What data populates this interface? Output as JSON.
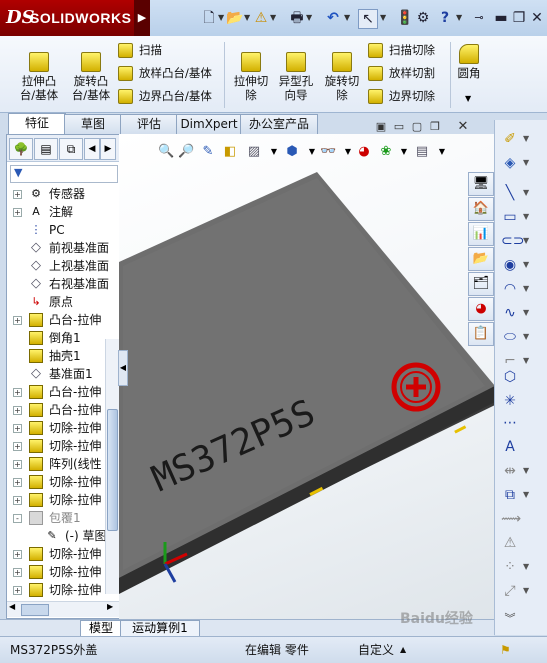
{
  "app": {
    "logo_text": "SOLIDWORKS",
    "logo_mark": "DS"
  },
  "colors": {
    "brand": "#a00000",
    "accent": "#1e3ea0",
    "model_face": "#6e6e6e"
  },
  "quick_toolbar": [
    {
      "icon": "new-document-icon"
    },
    {
      "icon": "open-folder-icon"
    },
    {
      "icon": "rebuild-icon"
    },
    {
      "icon": "print-icon"
    },
    {
      "icon": "undo-icon"
    },
    {
      "icon": "select-pointer-icon"
    },
    {
      "icon": "traffic-light-icon"
    },
    {
      "icon": "options-icon"
    },
    {
      "icon": "help-icon"
    }
  ],
  "ribbon": {
    "extrude_boss": "拉伸凸\n台/基体",
    "revolve_boss": "旋转凸\n台/基体",
    "sweep": "扫描",
    "loft_boss": "放样凸台/基体",
    "boundary_boss": "边界凸台/基体",
    "extrude_cut": "拉伸切\n除",
    "hole_wizard": "异型孔\n向导",
    "revolve_cut": "旋转切\n除",
    "swept_cut": "扫描切除",
    "lofted_cut": "放样切割",
    "boundary_cut": "边界切除",
    "fillet": "圆角"
  },
  "tabs": [
    "特征",
    "草图",
    "评估",
    "DimXpert",
    "办公室产品"
  ],
  "active_tab": "特征",
  "tree": [
    {
      "label": "传感器",
      "icon": "sensor-icon",
      "expand": "+"
    },
    {
      "label": "注解",
      "icon": "annotation-icon",
      "expand": "+"
    },
    {
      "label": "PC",
      "icon": "material-icon",
      "expand": ""
    },
    {
      "label": "前视基准面",
      "icon": "plane-icon",
      "expand": ""
    },
    {
      "label": "上视基准面",
      "icon": "plane-icon",
      "expand": ""
    },
    {
      "label": "右视基准面",
      "icon": "plane-icon",
      "expand": ""
    },
    {
      "label": "原点",
      "icon": "origin-icon",
      "expand": ""
    },
    {
      "label": "凸台-拉伸",
      "icon": "extrude-feature-icon",
      "expand": "+"
    },
    {
      "label": "倒角1",
      "icon": "chamfer-feature-icon",
      "expand": ""
    },
    {
      "label": "抽壳1",
      "icon": "shell-feature-icon",
      "expand": ""
    },
    {
      "label": "基准面1",
      "icon": "plane-icon",
      "expand": ""
    },
    {
      "label": "凸台-拉伸",
      "icon": "extrude-feature-icon",
      "expand": "+"
    },
    {
      "label": "凸台-拉伸",
      "icon": "extrude-feature-icon",
      "expand": "+"
    },
    {
      "label": "切除-拉伸",
      "icon": "cut-feature-icon",
      "expand": "+"
    },
    {
      "label": "切除-拉伸",
      "icon": "cut-feature-icon",
      "expand": "+"
    },
    {
      "label": "阵列(线性",
      "icon": "pattern-feature-icon",
      "expand": "+"
    },
    {
      "label": "切除-拉伸",
      "icon": "cut-feature-icon",
      "expand": "+"
    },
    {
      "label": "切除-拉伸",
      "icon": "cut-feature-icon",
      "expand": "+"
    },
    {
      "label": "包覆1",
      "icon": "wrap-feature-icon",
      "expand": "-"
    },
    {
      "label": "(-) 草图",
      "icon": "sketch-icon",
      "expand": ""
    },
    {
      "label": "切除-拉伸",
      "icon": "cut-feature-icon",
      "expand": "+"
    },
    {
      "label": "切除-拉伸",
      "icon": "cut-feature-icon",
      "expand": "+"
    },
    {
      "label": "切除-拉伸",
      "icon": "cut-feature-icon",
      "expand": "+"
    }
  ],
  "model": {
    "engraved_text": "MS372P5S"
  },
  "bottom_tabs": [
    "模型",
    "运动算例1"
  ],
  "status": {
    "part_name": "MS372P5S外盖",
    "mode": "在编辑 零件",
    "custom": "自定义"
  },
  "watermark": "Baidu经验"
}
